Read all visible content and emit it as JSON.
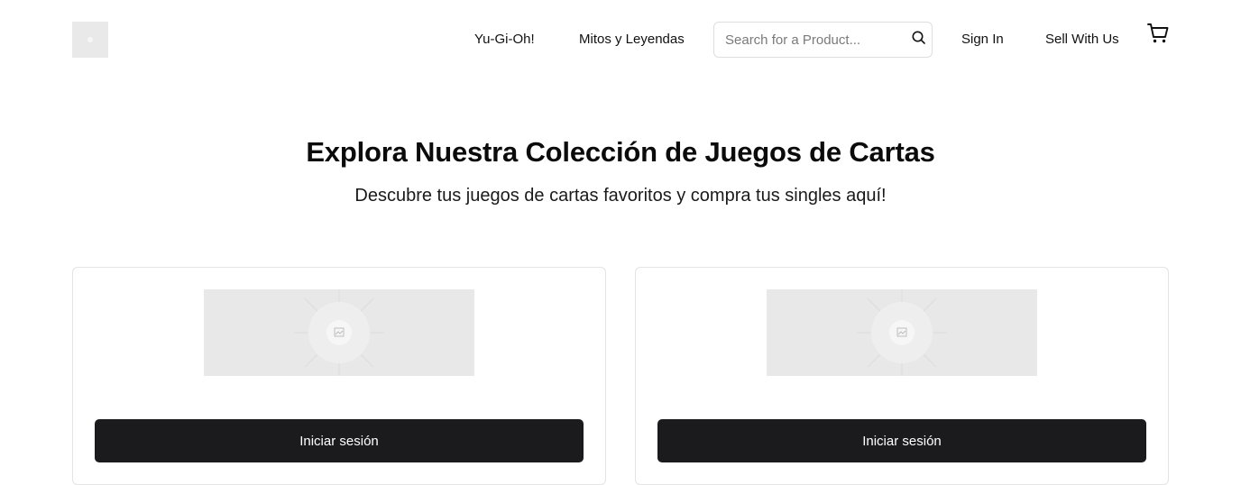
{
  "header": {
    "logo_icon": "placeholder-logo-icon",
    "nav": {
      "yugioh": "Yu-Gi-Oh!",
      "mitos": "Mitos y Leyendas",
      "signin": "Sign In",
      "sell": "Sell With Us"
    },
    "search": {
      "placeholder": "Search for a Product...",
      "value": "",
      "icon": "search-icon"
    },
    "cart_icon": "cart-icon"
  },
  "hero": {
    "title": "Explora Nuestra Colección de Juegos de Cartas",
    "subtitle": "Descubre tus juegos de cartas favoritos y compra tus singles aquí!"
  },
  "cards": [
    {
      "image_icon": "image-placeholder-icon",
      "button_label": "Iniciar sesión"
    },
    {
      "image_icon": "image-placeholder-icon",
      "button_label": "Iniciar sesión"
    }
  ],
  "colors": {
    "button_bg": "#1b1b1d",
    "placeholder_bg": "#e8e8e8",
    "border": "#e4e4e4"
  }
}
